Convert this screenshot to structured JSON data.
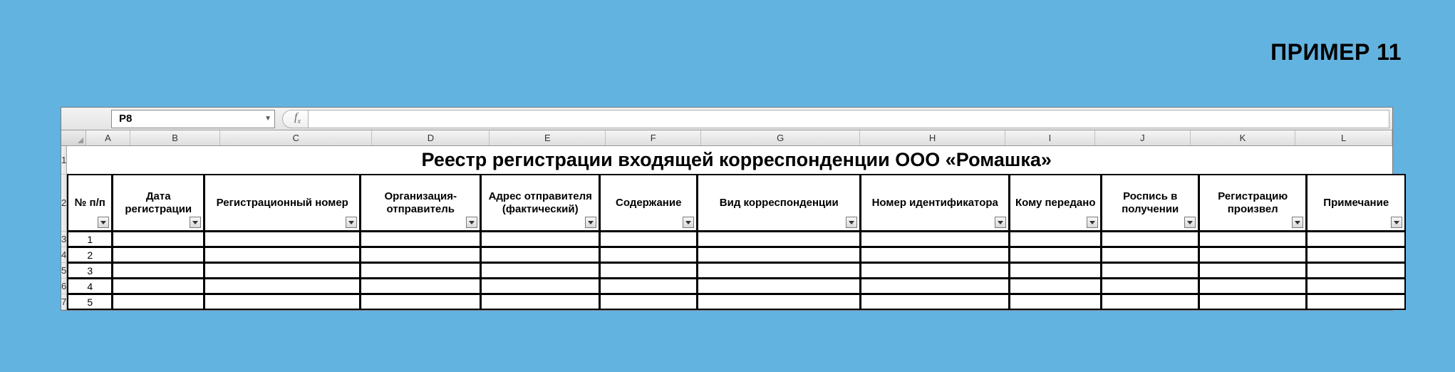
{
  "example_label": "ПРИМЕР 11",
  "namebox_value": "P8",
  "column_letters": [
    "A",
    "B",
    "C",
    "D",
    "E",
    "F",
    "G",
    "H",
    "I",
    "J",
    "K",
    "L"
  ],
  "row_numbers": [
    "1",
    "2",
    "3",
    "4",
    "5",
    "6",
    "7"
  ],
  "title": "Реестр регистрации входящей корреспонденции ООО «Ромашка»",
  "headers": [
    "№ п/п",
    "Дата регистрации",
    "Регистрационный номер",
    "Организация-отправитель",
    "Адрес отправителя (фактический)",
    "Содержание",
    "Вид корреспонденции",
    "Номер идентификатора",
    "Кому передано",
    "Роспись в получении",
    "Регистрацию произвел",
    "Примечание"
  ],
  "data_rows": [
    [
      "1",
      "",
      "",
      "",
      "",
      "",
      "",
      "",
      "",
      "",
      "",
      ""
    ],
    [
      "2",
      "",
      "",
      "",
      "",
      "",
      "",
      "",
      "",
      "",
      "",
      ""
    ],
    [
      "3",
      "",
      "",
      "",
      "",
      "",
      "",
      "",
      "",
      "",
      "",
      ""
    ],
    [
      "4",
      "",
      "",
      "",
      "",
      "",
      "",
      "",
      "",
      "",
      "",
      ""
    ],
    [
      "5",
      "",
      "",
      "",
      "",
      "",
      "",
      "",
      "",
      "",
      "",
      ""
    ]
  ]
}
